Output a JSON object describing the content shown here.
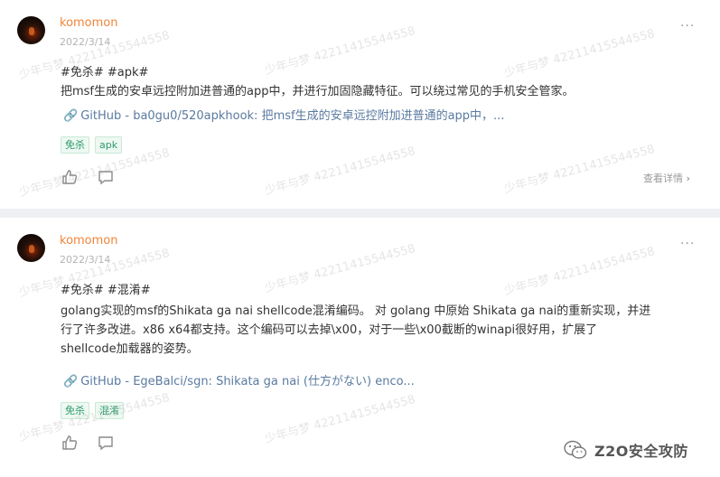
{
  "posts": [
    {
      "user": "komomon",
      "date": "2022/3/14",
      "more": "···",
      "tagline": "#免杀# #apk#",
      "body": "把msf生成的安卓远控附加进普通的app中，并进行加固隐藏特征。可以绕过常见的手机安全管家。",
      "link": "GitHub - ba0gu0/520apkhook: 把msf生成的安卓远控附加进普通的app中，...",
      "tags": [
        "免杀",
        "apk"
      ],
      "detail": "查看详情"
    },
    {
      "user": "komomon",
      "date": "2022/3/14",
      "more": "···",
      "tagline": "#免杀# #混淆#",
      "body_lines": [
        "golang实现的msf的Shikata ga nai shellcode混淆编码。 对 golang 中原始 Shikata ga nai的重新实现，并进",
        "行了许多改进。x86 x64都支持。这个编码可以去掉\\x00，对于一些\\x00截断的winapi很好用，扩展了",
        "shellcode加载器的姿势。"
      ],
      "link": "GitHub - EgeBalci/sgn: Shikata ga nai (仕方がない) enco...",
      "tags": [
        "免杀",
        "混淆"
      ]
    }
  ],
  "watermark": "少年与梦 42211415544558",
  "brand": "Z2O安全攻防",
  "icons": {
    "like": "thumbs-up-icon",
    "comment": "comment-icon",
    "more": "more-dots-icon",
    "link": "link-icon",
    "chevron": "chevron-right-icon",
    "brand": "wechat-icon"
  }
}
